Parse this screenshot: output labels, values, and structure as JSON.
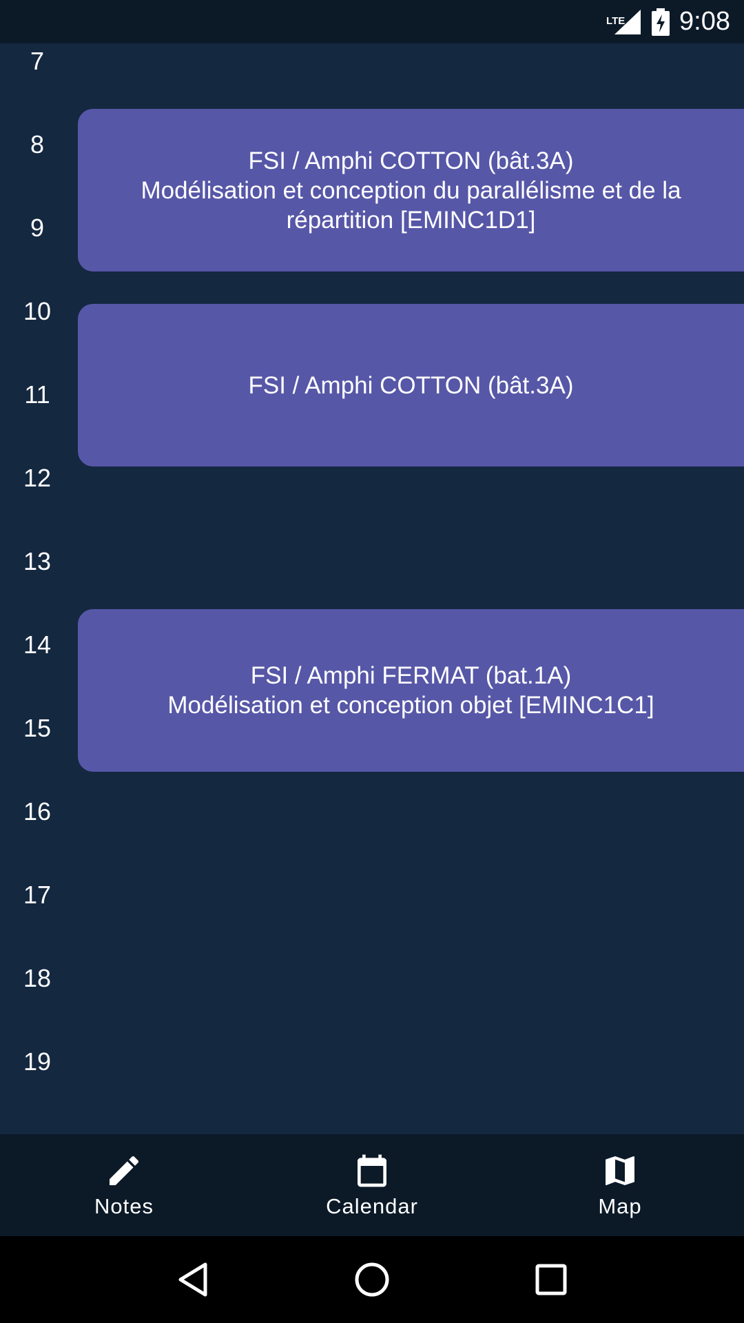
{
  "status_bar": {
    "time": "9:08",
    "network": "LTE",
    "icons": [
      "signal-icon",
      "battery-charging-icon"
    ]
  },
  "timeline": {
    "hours": [
      "7",
      "8",
      "9",
      "10",
      "11",
      "12",
      "13",
      "14",
      "15",
      "16",
      "17",
      "18",
      "19"
    ],
    "events": [
      {
        "line1": "FSI / Amphi COTTON (bât.3A)",
        "line2": "Modélisation et conception du parallélisme et de la répartition [EMINC1D1]"
      },
      {
        "line1": "FSI / Amphi COTTON (bât.3A)",
        "line2": ""
      },
      {
        "line1": "FSI / Amphi FERMAT (bat.1A)",
        "line2": "Modélisation et conception objet [EMINC1C1]"
      }
    ]
  },
  "bottom_nav": {
    "items": [
      {
        "label": "Notes",
        "icon": "pencil-icon"
      },
      {
        "label": "Calendar",
        "icon": "calendar-icon"
      },
      {
        "label": "Map",
        "icon": "map-icon"
      }
    ]
  },
  "system_nav": {
    "icons": [
      "back-icon",
      "home-icon",
      "recents-icon"
    ]
  },
  "colors": {
    "background": "#142840",
    "bar": "#0c1a28",
    "event": "#5757a8"
  }
}
